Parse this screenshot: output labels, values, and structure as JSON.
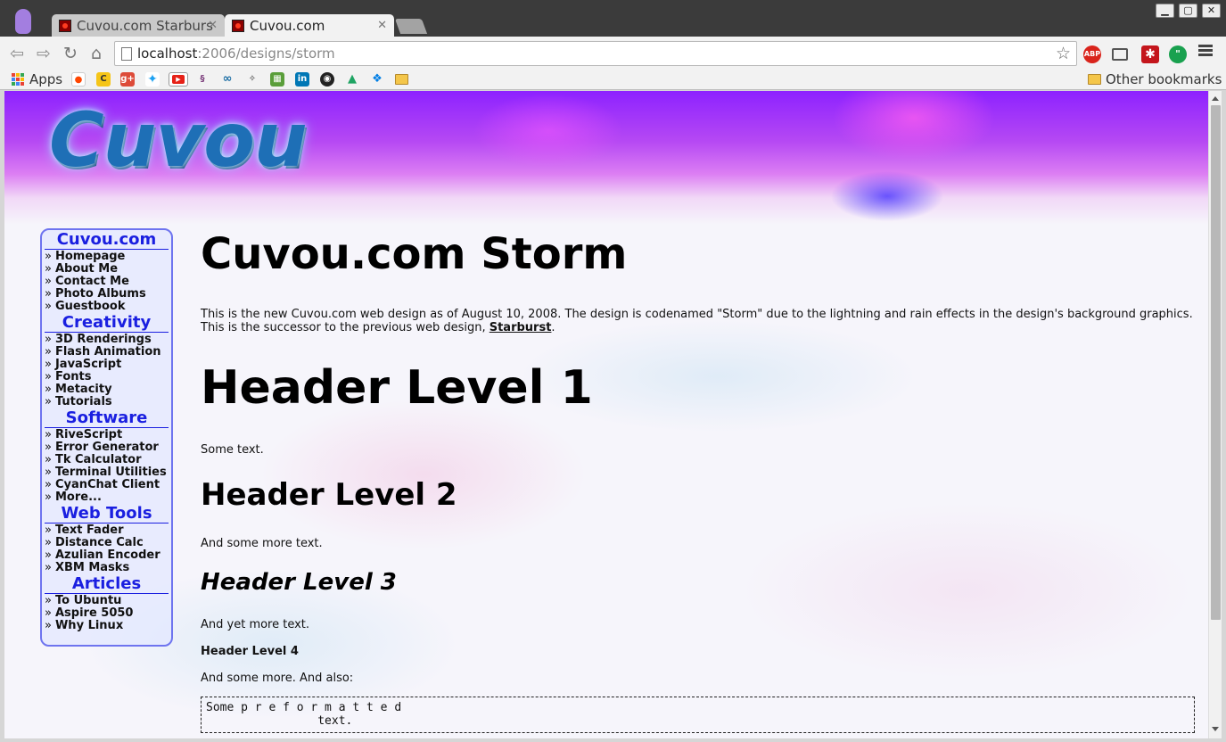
{
  "browser": {
    "tabs": [
      {
        "title": "Cuvou.com Starburs",
        "active": false
      },
      {
        "title": "Cuvou.com",
        "active": true
      }
    ],
    "url_host": "localhost",
    "url_rest": ":2006/designs/storm",
    "bookmarks_apps_label": "Apps",
    "other_bookmarks_label": "Other bookmarks",
    "extensions": [
      "adblock-plus-icon",
      "cast-icon",
      "lastpass-icon",
      "hangouts-icon"
    ]
  },
  "site": {
    "logo": "Cuvou",
    "nav": [
      {
        "heading": "Cuvou.com",
        "items": [
          "Homepage",
          "About Me",
          "Contact Me",
          "Photo Albums",
          "Guestbook"
        ]
      },
      {
        "heading": "Creativity",
        "items": [
          "3D Renderings",
          "Flash Animation",
          "JavaScript",
          "Fonts",
          "Metacity",
          "Tutorials"
        ]
      },
      {
        "heading": "Software",
        "items": [
          "RiveScript",
          "Error Generator",
          "Tk Calculator",
          "Terminal Utilities",
          "CyanChat Client",
          "More..."
        ]
      },
      {
        "heading": "Web Tools",
        "items": [
          "Text Fader",
          "Distance Calc",
          "Azulian Encoder",
          "XBM Masks"
        ]
      },
      {
        "heading": "Articles",
        "items": [
          "To Ubuntu",
          "Aspire 5050",
          "Why Linux"
        ]
      }
    ],
    "nav_arrow": "»",
    "content": {
      "title": "Cuvou.com Storm",
      "intro_text": "This is the new Cuvou.com web design as of August 10, 2008. The design is codenamed \"Storm\" due to the lightning and rain effects in the design's background graphics. This is the successor to the previous web design, ",
      "intro_link": "Starburst",
      "intro_end": ".",
      "h1": "Header Level 1",
      "p1": "Some text.",
      "h2": "Header Level 2",
      "p2": "And some more text.",
      "h3": "Header Level 3",
      "p3": "And yet more text.",
      "h4": "Header Level 4",
      "p4": "And some more. And also:",
      "pre": "Some p r e f o r m a t t e d\n                text."
    }
  },
  "colors": {
    "nav_heading": "#1a1fe0",
    "nav_border": "#6e74ef",
    "logo": "#1e6fb6",
    "banner_top": "#8d22ff"
  }
}
